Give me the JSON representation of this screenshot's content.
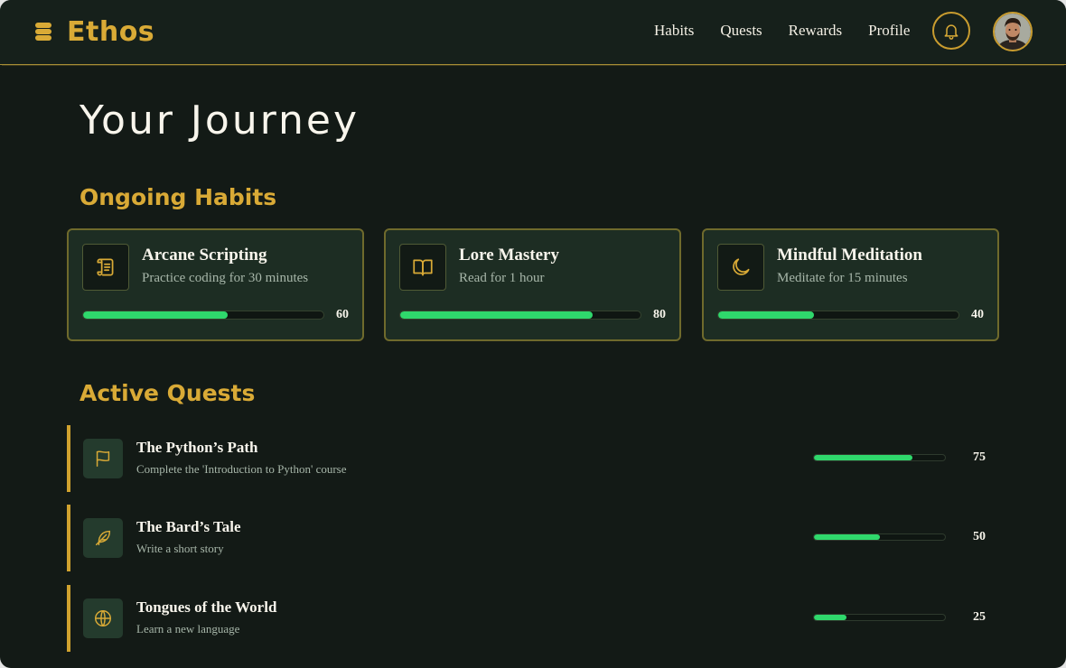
{
  "app": {
    "name": "Ethos",
    "logo_icon": "coin-stack-icon"
  },
  "nav": {
    "items": [
      {
        "label": "Habits"
      },
      {
        "label": "Quests"
      },
      {
        "label": "Rewards"
      },
      {
        "label": "Profile"
      }
    ],
    "notification_icon": "bell-icon",
    "avatar_icon": "user-avatar"
  },
  "page": {
    "title": "Your Journey"
  },
  "habits": {
    "title": "Ongoing Habits",
    "items": [
      {
        "icon": "scroll-icon",
        "name": "Arcane Scripting",
        "description": "Practice coding for 30 minutes",
        "progress": 60,
        "progress_label": "60"
      },
      {
        "icon": "book-icon",
        "name": "Lore Mastery",
        "description": "Read for 1 hour",
        "progress": 80,
        "progress_label": "80"
      },
      {
        "icon": "moon-icon",
        "name": "Mindful Meditation",
        "description": "Meditate for 15 minutes",
        "progress": 40,
        "progress_label": "40"
      }
    ]
  },
  "quests": {
    "title": "Active Quests",
    "items": [
      {
        "icon": "flag-icon",
        "name": "The Python’s Path",
        "description": "Complete the 'Introduction to Python' course",
        "progress": 75,
        "progress_label": "75"
      },
      {
        "icon": "feather-icon",
        "name": "The Bard’s Tale",
        "description": "Write a short story",
        "progress": 50,
        "progress_label": "50"
      },
      {
        "icon": "globe-icon",
        "name": "Tongues of the World",
        "description": "Learn a new language",
        "progress": 25,
        "progress_label": "25"
      }
    ]
  },
  "colors": {
    "background": "#131a16",
    "accent_gold": "#d9aa36",
    "progress_green": "#2fd86c",
    "card_background": "#1d2d23"
  }
}
